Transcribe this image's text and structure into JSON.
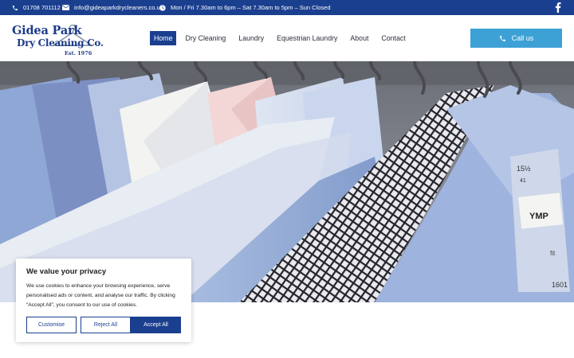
{
  "topbar": {
    "phone": "01708 701112",
    "email": "info@gideaparkdrycleaners.co.uk",
    "hours": "Mon / Fri 7.30am to 6pm – Sat 7.30am to 5pm – Sun Closed",
    "social_icon": "facebook-icon"
  },
  "logo": {
    "line1": "Gidea Park",
    "line2": "Dry Cleaning Co.",
    "line3": "Est. 1976"
  },
  "nav": {
    "items": [
      {
        "label": "Home",
        "active": true
      },
      {
        "label": "Dry Cleaning"
      },
      {
        "label": "Laundry"
      },
      {
        "label": "Equestrian Laundry"
      },
      {
        "label": "About"
      },
      {
        "label": "Contact"
      }
    ]
  },
  "call_button": {
    "label": "Call us",
    "icon": "phone-icon"
  },
  "hero": {
    "label_size": "15½",
    "label_size2": "41",
    "label_brand": "YMP",
    "label_fit": "fit",
    "label_num": "1601"
  },
  "cookie": {
    "title": "We value your privacy",
    "body": "We use cookies to enhance your browsing experience, serve personalised ads or content, and analyse our traffic. By clicking “Accept All”, you consent to our use of cookies.",
    "customise": "Customise",
    "reject": "Reject All",
    "accept": "Accept All"
  },
  "colors": {
    "brand_navy": "#1b3f8f",
    "call_blue": "#3da1d6"
  }
}
